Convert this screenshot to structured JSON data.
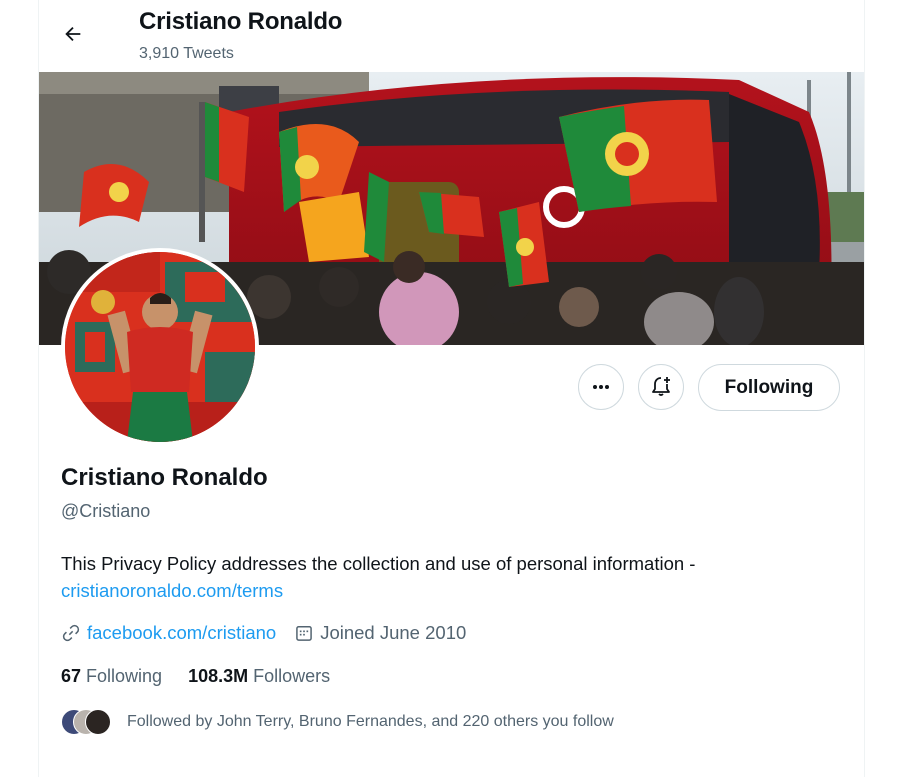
{
  "header": {
    "name": "Cristiano Ronaldo",
    "tweet_count": "3,910 Tweets"
  },
  "profile": {
    "name": "Cristiano Ronaldo",
    "handle": "@Cristiano",
    "bio_text": "This Privacy Policy addresses the collection and use of personal information -",
    "bio_link": "cristianoronaldo.com/terms",
    "website": "facebook.com/cristiano",
    "joined": "Joined June 2010"
  },
  "actions": {
    "more_icon": "more-icon",
    "notify_icon": "bell-plus-icon",
    "following_label": "Following"
  },
  "stats": {
    "following_count": "67",
    "following_label": "Following",
    "followers_count": "108.3M",
    "followers_label": "Followers"
  },
  "followed_by": "Followed by John Terry, Bruno Fernandes, and 220 others you follow",
  "colors": {
    "link": "#1d9bf0",
    "secondary_text": "#536471",
    "border": "#cfd9de",
    "portugal_red": "#d9301e",
    "portugal_green": "#1f8a3a"
  }
}
